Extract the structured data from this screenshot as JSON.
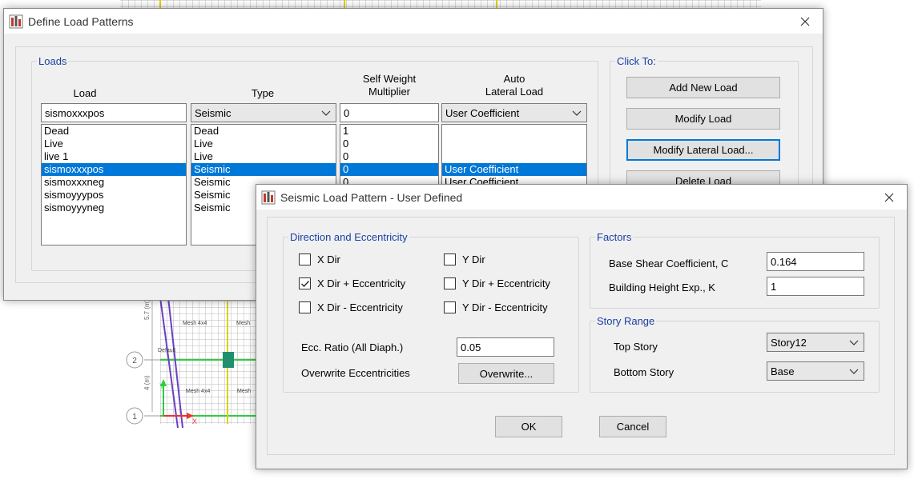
{
  "define_dialog": {
    "title": "Define Load Patterns",
    "loads_group": "Loads",
    "col_load": "Load",
    "col_type": "Type",
    "col_sw_line1": "Self Weight",
    "col_sw_line2": "Multiplier",
    "col_auto_line1": "Auto",
    "col_auto_line2": "Lateral Load",
    "edit_load": "sismoxxxpos",
    "edit_type": "Seismic",
    "edit_sw": "0",
    "edit_auto": "User Coefficient",
    "rows": [
      {
        "load": "Dead",
        "type": "Dead",
        "sw": "1",
        "auto": ""
      },
      {
        "load": "Live",
        "type": "Live",
        "sw": "0",
        "auto": ""
      },
      {
        "load": "live 1",
        "type": "Live",
        "sw": "0",
        "auto": ""
      },
      {
        "load": "sismoxxxpos",
        "type": "Seismic",
        "sw": "0",
        "auto": "User Coefficient"
      },
      {
        "load": "sismoxxxneg",
        "type": "Seismic",
        "sw": "0",
        "auto": "User Coefficient"
      },
      {
        "load": "sismoyyypos",
        "type": "Seismic",
        "sw": "",
        "auto": ""
      },
      {
        "load": "sismoyyyneg",
        "type": "Seismic",
        "sw": "",
        "auto": ""
      }
    ],
    "selected_row": 3,
    "click_to_group": "Click To:",
    "add_new_load": "Add New Load",
    "modify_load": "Modify Load",
    "modify_lateral_load": "Modify Lateral Load...",
    "delete_load": "Delete Load"
  },
  "seismic_dialog": {
    "title": "Seismic Load Pattern - User Defined",
    "direction_group": "Direction and Eccentricity",
    "checks": [
      {
        "label": "X Dir",
        "checked": false
      },
      {
        "label": "Y Dir",
        "checked": false
      },
      {
        "label": "X Dir + Eccentricity",
        "checked": true
      },
      {
        "label": "Y Dir + Eccentricity",
        "checked": false
      },
      {
        "label": "X Dir - Eccentricity",
        "checked": false
      },
      {
        "label": "Y Dir - Eccentricity",
        "checked": false
      }
    ],
    "ecc_ratio_label": "Ecc. Ratio (All Diaph.)",
    "ecc_ratio_value": "0.05",
    "overwrite_label": "Overwrite Eccentricities",
    "overwrite_button": "Overwrite...",
    "factors_group": "Factors",
    "base_shear_label": "Base Shear Coefficient, C",
    "base_shear_value": "0.164",
    "height_exp_label": "Building Height Exp., K",
    "height_exp_value": "1",
    "story_range_group": "Story Range",
    "top_story_label": "Top Story",
    "top_story_value": "Story12",
    "bottom_story_label": "Bottom Story",
    "bottom_story_value": "Base",
    "ok": "OK",
    "cancel": "Cancel"
  },
  "drawing": {
    "grid_bubble_2": "2",
    "grid_bubble_1": "1",
    "dim_upper": "5.7 (m)",
    "dim_lower": "4 (m)",
    "mesh_label_1": "Mesh 4x4",
    "mesh_label_2": "Mesh",
    "mesh_label_3": "Mesh 4x4",
    "mesh_label_4": "Mesh",
    "default_label": "Default",
    "axis_y": "Y",
    "axis_x": "X"
  },
  "colors": {
    "accent": "#0078d7",
    "group_title": "#1a3fa5",
    "dialog_bg": "#f0f0f0"
  }
}
